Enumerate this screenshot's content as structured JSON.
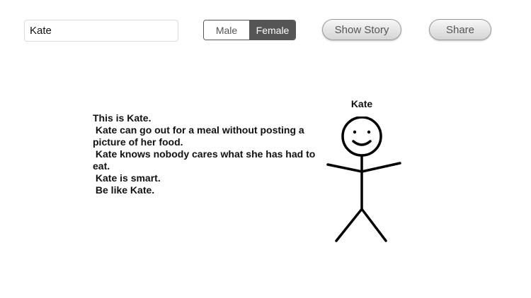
{
  "form": {
    "name_value": "Kate"
  },
  "gender_toggle": {
    "options": [
      "Male",
      "Female"
    ],
    "selected": "Female"
  },
  "buttons": {
    "show_story": "Show Story",
    "share": "Share"
  },
  "story": {
    "text": "This is Kate.\n Kate can go out for a meal without posting a picture of her food.\n Kate knows nobody cares what she has had to eat.\n Kate is smart.\n Be like Kate."
  },
  "figure": {
    "name": "Kate",
    "icon": "stick-figure-icon"
  }
}
